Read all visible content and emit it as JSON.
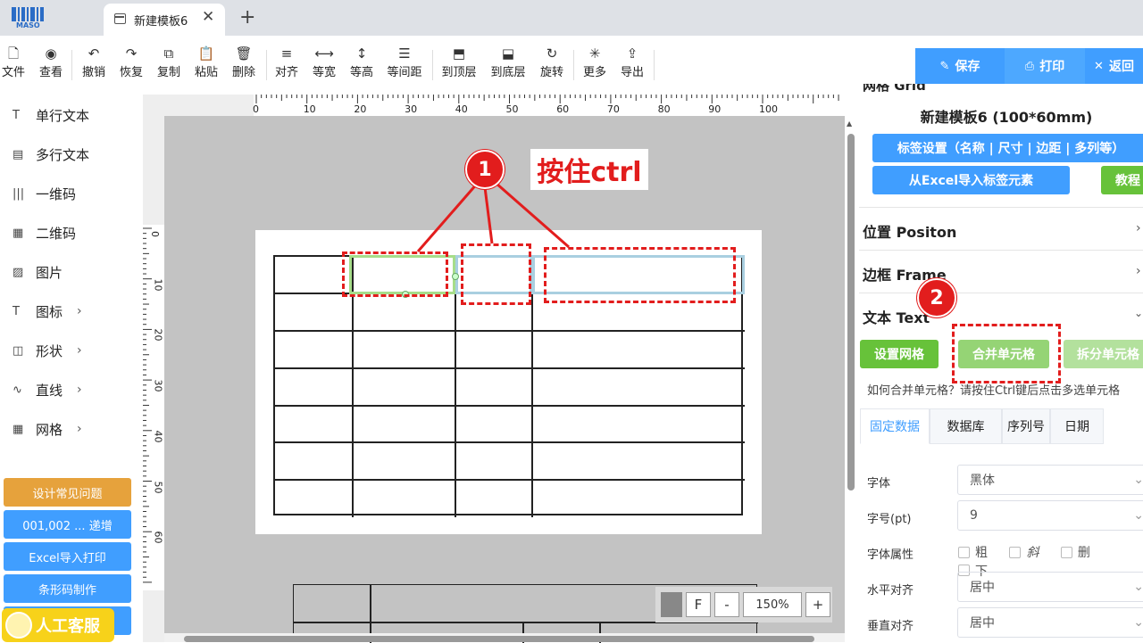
{
  "browser": {
    "logo_text": "MASO",
    "tab_title": "新建模板6",
    "close_glyph": "✕",
    "new_tab_glyph": "+"
  },
  "toolbar": {
    "items": [
      {
        "label": "文件",
        "icon": "file-icon"
      },
      {
        "label": "查看",
        "icon": "eye-icon"
      },
      {
        "label": "撤销",
        "icon": "undo-icon"
      },
      {
        "label": "恢复",
        "icon": "redo-icon"
      },
      {
        "label": "复制",
        "icon": "copy-icon"
      },
      {
        "label": "粘贴",
        "icon": "paste-icon"
      },
      {
        "label": "删除",
        "icon": "trash-icon"
      },
      {
        "label": "对齐",
        "icon": "align-icon"
      },
      {
        "label": "等宽",
        "icon": "equal-width-icon"
      },
      {
        "label": "等高",
        "icon": "equal-height-icon"
      },
      {
        "label": "等间距",
        "icon": "equal-spacing-icon"
      },
      {
        "label": "到顶层",
        "icon": "bring-front-icon"
      },
      {
        "label": "到底层",
        "icon": "send-back-icon"
      },
      {
        "label": "旋转",
        "icon": "rotate-icon"
      },
      {
        "label": "更多",
        "icon": "more-icon"
      },
      {
        "label": "导出",
        "icon": "export-icon"
      }
    ],
    "save": "保存",
    "print": "打印",
    "back": "返回"
  },
  "sidebar": {
    "items": [
      {
        "label": "单行文本",
        "icon": "text-icon"
      },
      {
        "label": "多行文本",
        "icon": "multiline-text-icon"
      },
      {
        "label": "一维码",
        "icon": "barcode-icon"
      },
      {
        "label": "二维码",
        "icon": "qrcode-icon"
      },
      {
        "label": "图片",
        "icon": "image-icon"
      },
      {
        "label": "图标",
        "icon": "symbol-icon"
      },
      {
        "label": "形状",
        "icon": "shape-icon"
      },
      {
        "label": "直线",
        "icon": "line-icon"
      },
      {
        "label": "网格",
        "icon": "grid-icon"
      }
    ],
    "buttons": [
      "设计常见问题",
      "001,002 ... 递增",
      "Excel导入打印",
      "条形码制作"
    ],
    "support": "人工客服"
  },
  "canvas": {
    "ruler_top": [
      "0",
      "10",
      "20",
      "30",
      "40",
      "50",
      "60",
      "70",
      "80",
      "90",
      "100"
    ],
    "ruler_left": [
      "0",
      "10",
      "20",
      "30",
      "40",
      "50",
      "60"
    ],
    "annotation_1": "1",
    "annotation_2": "2",
    "ctrl_note": "按住ctrl",
    "zoom": "150%",
    "zoom_f": "F",
    "zoom_minus": "-",
    "zoom_plus": "+"
  },
  "panel": {
    "partial_heading": "网格 Grid",
    "template_title": "新建模板6 (100*60mm)",
    "label_settings": "标签设置（名称 | 尺寸 | 边距 | 多列等）",
    "excel_import": "从Excel导入标签元素",
    "tutorial": "教程",
    "position": "位置 Positon",
    "frame": "边框 Frame",
    "text": "文本 Text",
    "set_grid": "设置网格",
    "merge": "合并单元格",
    "split": "拆分单元格",
    "hint": "如何合并单元格？请按住Ctrl键后点击多选单元格",
    "tabs": [
      "固定数据",
      "数据库",
      "序列号",
      "日期"
    ],
    "font_label": "字体",
    "font_value": "黑体",
    "size_label": "字号(pt)",
    "size_value": "9",
    "style_label": "字体属性",
    "styles": [
      "粗",
      "斜",
      "删",
      "下"
    ],
    "halign_label": "水平对齐",
    "halign_value": "居中",
    "valign_label": "垂直对齐",
    "valign_value": "居中"
  },
  "colors": {
    "primary": "#409eff",
    "green": "#67c23a",
    "light_green": "#95d475",
    "orange": "#e6a23c",
    "annotation_red": "#e21d1d"
  }
}
